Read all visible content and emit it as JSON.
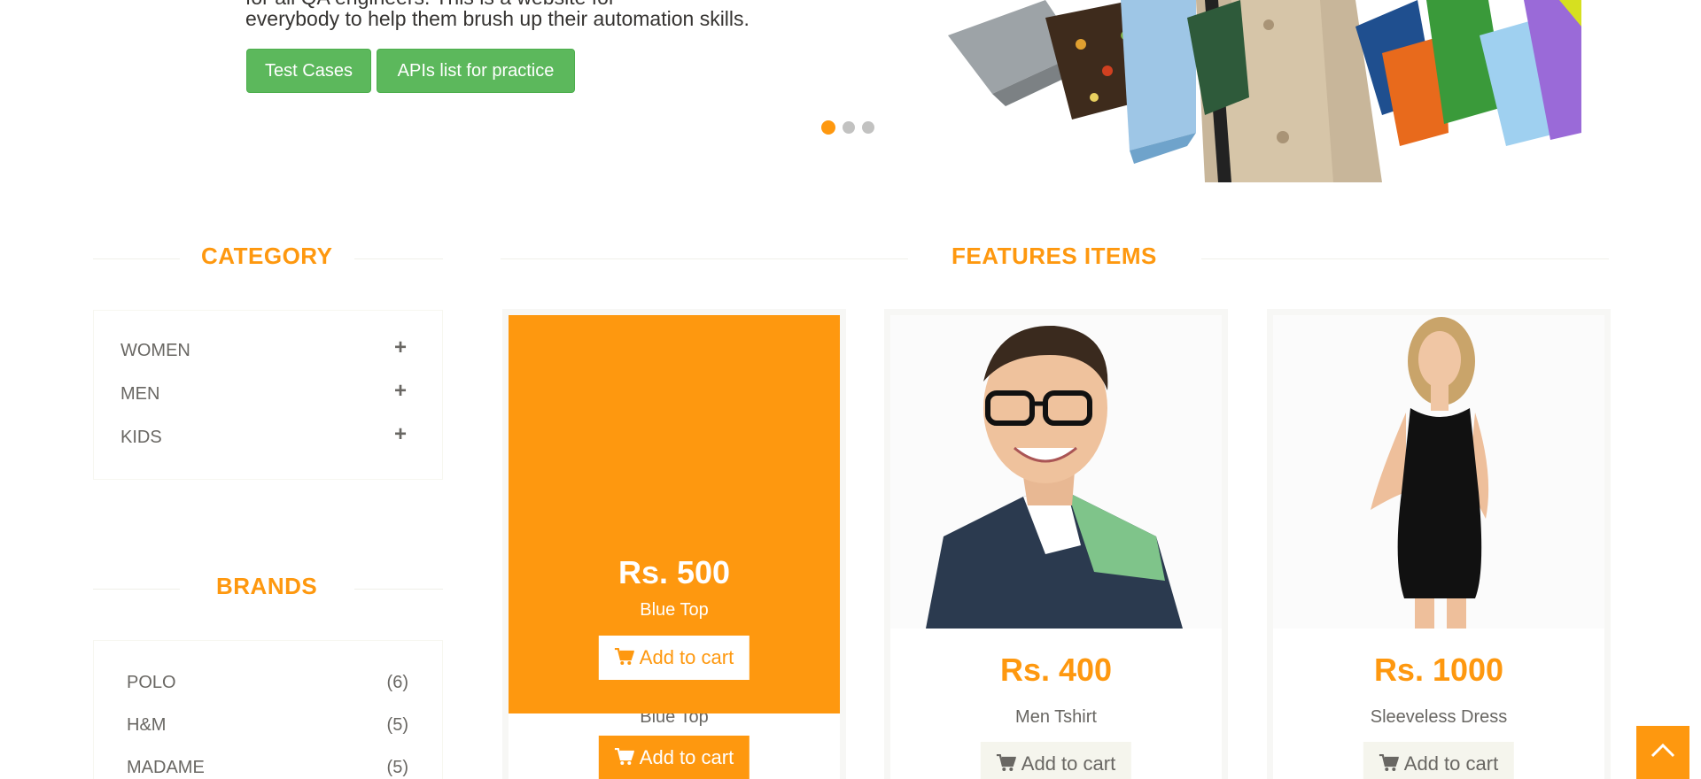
{
  "hero": {
    "line_partial": "for all QA engineers. This is a website for",
    "line": "everybody to help them brush up their automation skills.",
    "buttons": {
      "test_cases": "Test Cases",
      "apis_list": "APIs list for practice"
    },
    "slides": 3,
    "active_slide": 1
  },
  "sidebar": {
    "category_title": "Category",
    "categories": [
      {
        "label": "Women",
        "toggle": "+"
      },
      {
        "label": "Men",
        "toggle": "+"
      },
      {
        "label": "Kids",
        "toggle": "+"
      }
    ],
    "brands_title": "Brands",
    "brands": [
      {
        "name": "Polo",
        "count": "(6)"
      },
      {
        "name": "H&M",
        "count": "(5)"
      },
      {
        "name": "Madame",
        "count": "(5)"
      }
    ]
  },
  "features": {
    "title": "Features Items",
    "products": [
      {
        "price": "Rs. 500",
        "name": "Blue Top",
        "cart_label": "Add to cart",
        "hovered": true
      },
      {
        "price": "Rs. 400",
        "name": "Men Tshirt",
        "cart_label": "Add to cart",
        "hovered": false
      },
      {
        "price": "Rs. 1000",
        "name": "Sleeveless Dress",
        "cart_label": "Add to cart",
        "hovered": false
      }
    ]
  },
  "colors": {
    "accent": "#fe980f",
    "success": "#5cb85c",
    "text": "#696763"
  },
  "icons": {
    "cart": "shopping-cart-icon",
    "plus": "plus-icon",
    "scroll_up": "chevron-up-icon"
  }
}
